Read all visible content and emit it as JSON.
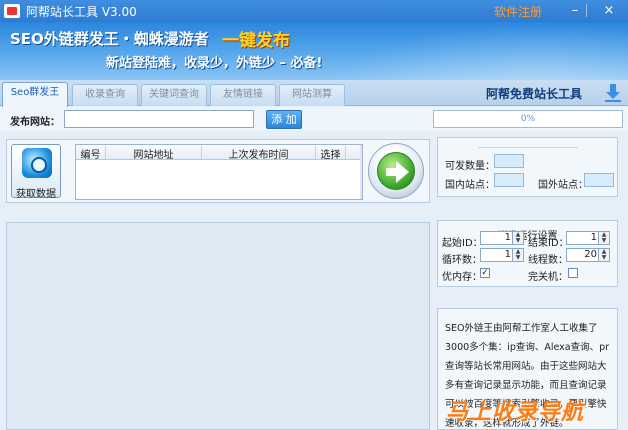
{
  "window": {
    "title": "阿帮站长工具 V3.00",
    "register": "软件注册",
    "minimize": "–",
    "close": "×"
  },
  "banner": {
    "headline": "SEO外链群发王・蜘蛛漫游者",
    "highlight": "一键发布",
    "slogan": "新站登陆难，收录少，外链少 – 必备!"
  },
  "tabs": [
    {
      "label": "Seo群发王",
      "active": true
    },
    {
      "label": "收录查询",
      "active": false
    },
    {
      "label": "关键词查询",
      "active": false
    },
    {
      "label": "友情链接",
      "active": false
    },
    {
      "label": "网站测算",
      "active": false
    }
  ],
  "brand": "阿帮免费站长工具",
  "publish": {
    "label": "发布网站：",
    "input_value": "",
    "add_button": "添 加",
    "progress_percent": 0,
    "progress_text": "0%"
  },
  "fetch_button": "获取数据",
  "table": {
    "columns": [
      "编号",
      "网站地址",
      "上次发布时间",
      "选择"
    ],
    "rows": []
  },
  "stats": {
    "sendable_label": "可发数量：",
    "sendable_value": "",
    "domestic_label": "国内站点：",
    "domestic_value": "",
    "foreign_label": "国外站点：",
    "foreign_value": ""
  },
  "settings": {
    "title": "群发运行设置",
    "start_id_label": "起始ID：",
    "start_id_value": "1",
    "end_id_label": "结束ID：",
    "end_id_value": "1",
    "loop_label": "循环数：",
    "loop_value": "1",
    "threads_label": "线程数：",
    "threads_value": "20",
    "optimize_label": "优内存：",
    "optimize_checked": true,
    "shutdown_label": "完关机：",
    "shutdown_checked": false
  },
  "description": "SEO外链王由阿帮工作室人工收集了3000多个集：ip查询、Alexa查询、pr查询等站长常用网站。由于这些网站大多有查询记录显示功能，而且查询记录可以被百度等搜索引擎收录，要引擎快速收录，这样就形成了外链。",
  "watermark": "马上收录导航",
  "colors": {
    "titlebar": "#2f7bd2",
    "accent_orange": "#ff9a2a",
    "highlight_yellow": "#ffd21e"
  }
}
